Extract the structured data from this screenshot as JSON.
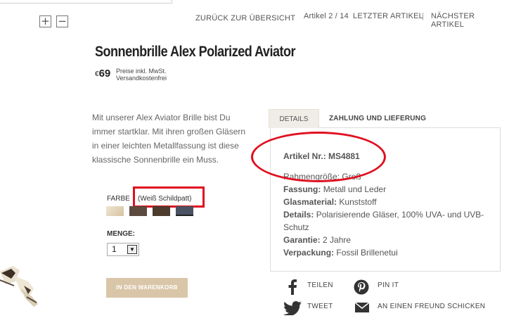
{
  "nav": {
    "back": "ZURÜCK ZUR ÜBERSICHT",
    "count": "Artikel 2 / 14",
    "last": "LETZTER ARTIKEL",
    "separator": "|",
    "next": "NÄCHSTER ARTIKEL"
  },
  "zoom": {
    "in": "+",
    "out": "−"
  },
  "product": {
    "title": "Sonnenbrille Alex Polarized Aviator",
    "currency": "€",
    "price": "69",
    "price_note_1": "Preise inkl. MwSt.",
    "price_note_2": "Versandkostenfrei",
    "description": "Mit unserer Alex Aviator Brille bist Du immer startklar. Mit ihren großen Gläsern in einer leichten Metallfassung ist diese klassische Sonnenbrille ein Muss."
  },
  "options": {
    "color_label": "FARBE",
    "color_value": "(Weiß Schildpatt)",
    "swatches": [
      "#e9dcc3",
      "#5b4a3d",
      "#4d3b2e",
      "#4b5262"
    ],
    "quantity_label": "MENGE:",
    "quantity_value": "1",
    "quantity_arrow": "▼"
  },
  "cart": {
    "label": "IN DEN WARENKORB"
  },
  "tabs": {
    "details": "DETAILS",
    "payment": "ZAHLUNG UND LIEFERUNG"
  },
  "details": {
    "article": "Artikel Nr.: MS4881",
    "frame_size": "Rahmengröße: Groß",
    "frame_label": "Fassung:",
    "frame_value": "Metall und Leder",
    "glass_label": "Glasmaterial:",
    "glass_value": "Kunststoff",
    "details_label": "Details:",
    "details_value": "Polarisierende Gläser, 100% UVA- und UVB-",
    "details_value_2": "Schutz",
    "warranty_label": "Garantie:",
    "warranty_value": "2 Jahre",
    "packaging_label": "Verpackung:",
    "packaging_value": "Fossil Brillenetui"
  },
  "social": {
    "share": "TEILEN",
    "pin": "PIN IT",
    "tweet": "TWEET",
    "mail": "AN EINEN FREUND SCHICKEN"
  },
  "colors": {
    "annotation_red": "#e01020",
    "cart_button": "#d9c6a8",
    "tab_bg": "#f0ede6"
  }
}
